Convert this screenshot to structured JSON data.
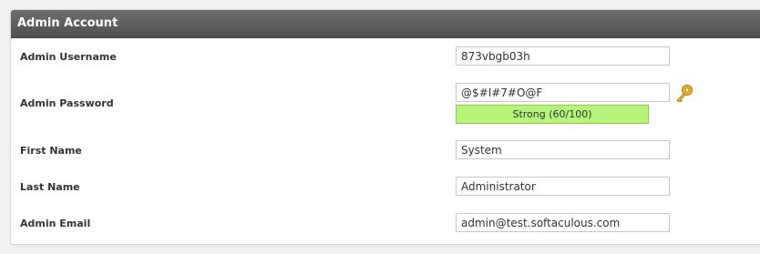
{
  "panel": {
    "title": "Admin Account"
  },
  "fields": {
    "username": {
      "label": "Admin Username",
      "value": "873vbgb03h"
    },
    "password": {
      "label": "Admin Password",
      "value": "@$#I#7#O@F",
      "strength": "Strong (60/100)"
    },
    "first_name": {
      "label": "First Name",
      "value": "System"
    },
    "last_name": {
      "label": "Last Name",
      "value": "Administrator"
    },
    "email": {
      "label": "Admin Email",
      "value": "admin@test.softaculous.com"
    }
  },
  "icons": {
    "password_generate": "key-icon"
  },
  "colors": {
    "header": "#5a5a5a",
    "strength_bg": "#b5f57a",
    "strength_border": "#8fce3a",
    "key": "#e8a317"
  }
}
